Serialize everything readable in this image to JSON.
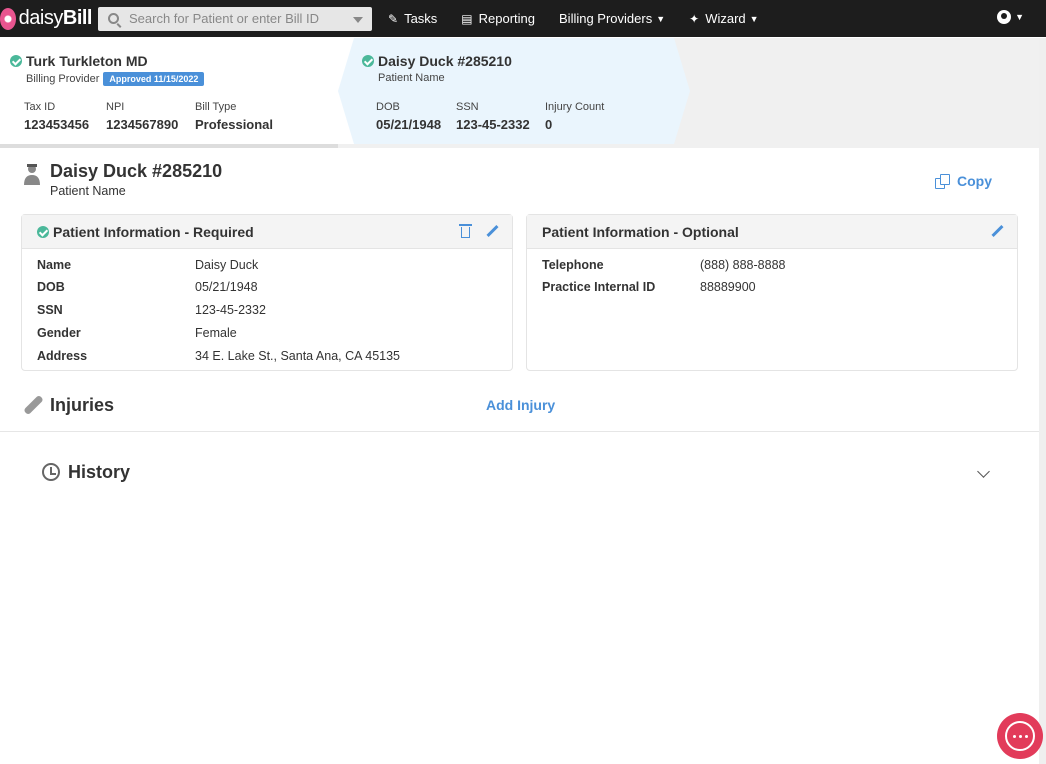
{
  "topbar": {
    "logo_prefix": "daisy",
    "logo_suffix": "Bill",
    "search_placeholder": "Search for Patient or enter Bill ID",
    "nav": [
      {
        "label": "Tasks",
        "icon": "clipboard-icon"
      },
      {
        "label": "Reporting",
        "icon": "bar-chart-icon"
      },
      {
        "label": "Billing Providers",
        "icon": "chevron-down-icon"
      },
      {
        "label": "Wizard",
        "icon": "wand-icon"
      }
    ]
  },
  "provider": {
    "name": "Turk Turkleton MD",
    "role": "Billing Provider",
    "badge": "Approved 11/15/2022",
    "tax_id_label": "Tax ID",
    "tax_id": "123453456",
    "npi_label": "NPI",
    "npi": "1234567890",
    "bill_type_label": "Bill Type",
    "bill_type": "Professional"
  },
  "patient_card": {
    "name": "Daisy Duck #285210",
    "sub": "Patient Name",
    "dob_label": "DOB",
    "dob": "05/21/1948",
    "ssn_label": "SSN",
    "ssn": "123-45-2332",
    "injury_label": "Injury Count",
    "injury_count": "0"
  },
  "patient": {
    "title": "Daisy Duck #285210",
    "subtitle": "Patient Name",
    "copy_label": "Copy"
  },
  "required_panel": {
    "title": "Patient Information - Required",
    "rows": [
      {
        "label": "Name",
        "value": "Daisy Duck"
      },
      {
        "label": "DOB",
        "value": "05/21/1948"
      },
      {
        "label": "SSN",
        "value": "123-45-2332"
      },
      {
        "label": "Gender",
        "value": "Female"
      },
      {
        "label": "Address",
        "value": "34 E. Lake St., Santa Ana, CA 45135"
      }
    ]
  },
  "optional_panel": {
    "title": "Patient Information - Optional",
    "rows": [
      {
        "label": "Telephone",
        "value": "(888) 888-8888"
      },
      {
        "label": "Practice Internal ID",
        "value": "88889900"
      }
    ]
  },
  "injuries": {
    "title": "Injuries",
    "add_label": "Add Injury"
  },
  "history": {
    "title": "History"
  },
  "colors": {
    "accent": "#4a90d9",
    "success": "#4bb89a",
    "topbar": "#1d1d1d",
    "chat": "#e23b5a"
  }
}
